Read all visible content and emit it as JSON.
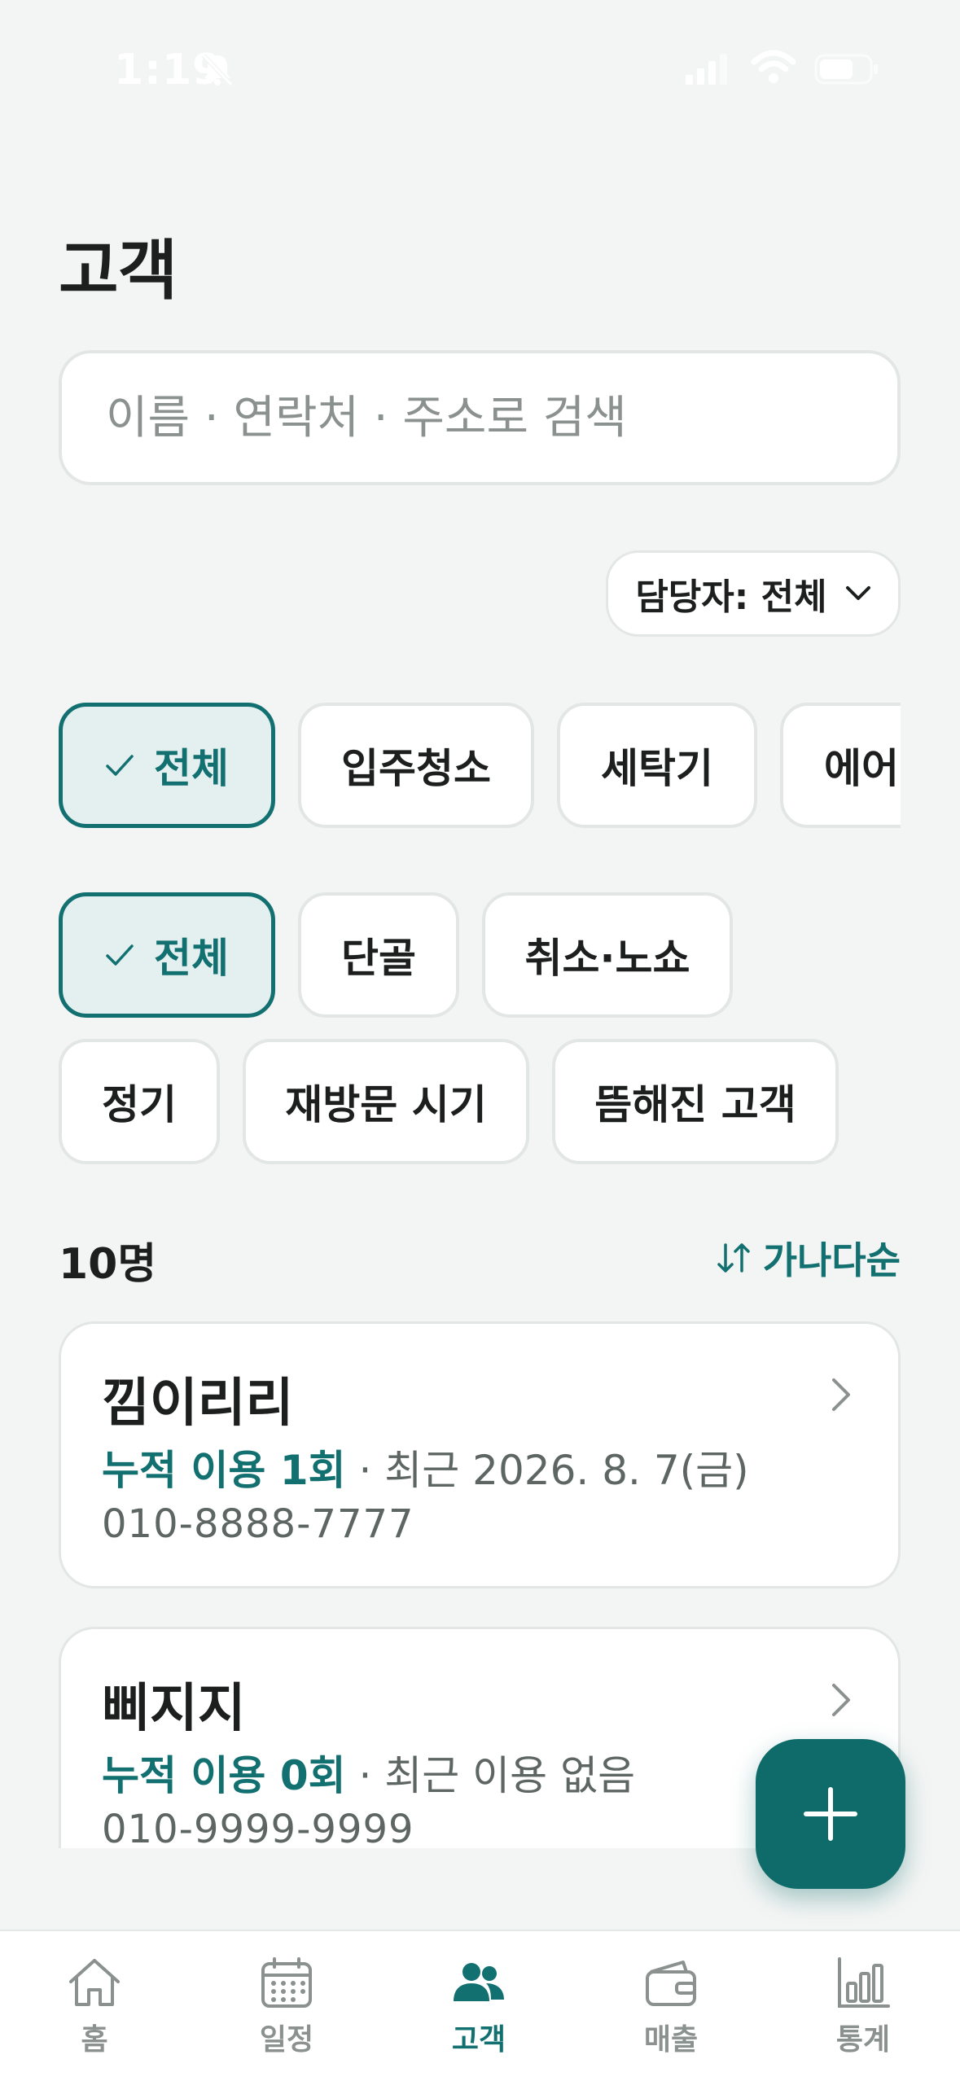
{
  "status_bar": {
    "time": "1:19"
  },
  "page": {
    "title": "고객"
  },
  "search": {
    "placeholder": "이름 · 연락처 · 주소로 검색"
  },
  "manager_filter": {
    "label": "담당자: 전체"
  },
  "service_filters": [
    {
      "label": "전체",
      "selected": true
    },
    {
      "label": "입주청소",
      "selected": false
    },
    {
      "label": "세탁기",
      "selected": false
    },
    {
      "label": "에어",
      "selected": false
    }
  ],
  "status_filters": [
    {
      "label": "전체",
      "selected": true
    },
    {
      "label": "단골",
      "selected": false
    },
    {
      "label": "취소·노쇼",
      "selected": false
    },
    {
      "label": "정기",
      "selected": false
    },
    {
      "label": "재방문 시기",
      "selected": false
    },
    {
      "label": "뜸해진 고객",
      "selected": false
    }
  ],
  "list": {
    "count": "10명",
    "sort": "가나다순",
    "customers": [
      {
        "name": "낌이리리",
        "usage": "누적 이용 1회",
        "recent": " · 최근 2026. 8. 7(금)",
        "phone": "010-8888-7777"
      },
      {
        "name": "삐지지",
        "usage": "누적 이용 0회",
        "recent": " · 최근 이용 없음",
        "phone": "010-9999-9999"
      }
    ]
  },
  "tabs": [
    {
      "label": "홈",
      "icon": "home-icon",
      "active": false
    },
    {
      "label": "일정",
      "icon": "calendar-icon",
      "active": false
    },
    {
      "label": "고객",
      "icon": "people-icon",
      "active": true
    },
    {
      "label": "매출",
      "icon": "wallet-icon",
      "active": false
    },
    {
      "label": "통계",
      "icon": "bar-chart-icon",
      "active": false
    }
  ],
  "colors": {
    "accent": "#127070",
    "fab": "#0f6b69",
    "selected_chip_bg": "#e3f0ef",
    "background": "#f3f5f4"
  }
}
